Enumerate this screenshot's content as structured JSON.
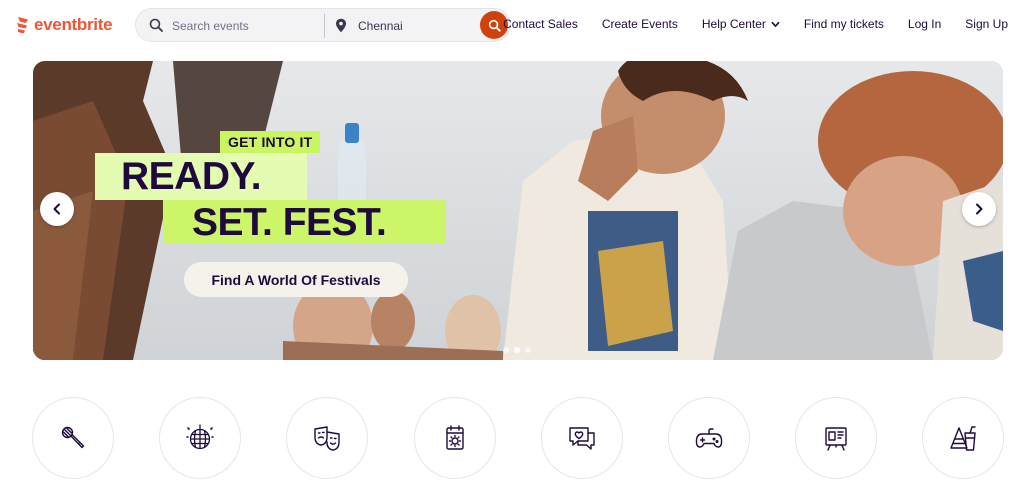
{
  "header": {
    "logo_text": "eventbrite",
    "brand_color": "#f05537",
    "search": {
      "placeholder": "Search events",
      "icon": "search-icon",
      "location_value": "Chennai",
      "location_icon": "map-pin-icon",
      "submit_icon": "search-icon",
      "submit_color": "#d1410c"
    },
    "nav": [
      {
        "label": "Contact Sales"
      },
      {
        "label": "Create Events"
      },
      {
        "label": "Help Center",
        "icon": "chevron-down-icon"
      },
      {
        "label": "Find my tickets"
      },
      {
        "label": "Log In"
      },
      {
        "label": "Sign Up"
      }
    ]
  },
  "hero": {
    "tag": "GET INTO IT",
    "line1": "READY.",
    "line2": "SET. FEST.",
    "cta": "Find A World Of Festivals",
    "accent_color": "#c8f560",
    "prev_icon": "chevron-left-icon",
    "next_icon": "chevron-right-icon",
    "slides_total": 3,
    "active_slide": 2
  },
  "categories": [
    {
      "icon": "microphone-icon"
    },
    {
      "icon": "disco-ball-icon"
    },
    {
      "icon": "theater-masks-icon"
    },
    {
      "icon": "calendar-icon"
    },
    {
      "icon": "chat-heart-icon"
    },
    {
      "icon": "game-controller-icon"
    },
    {
      "icon": "presentation-board-icon"
    },
    {
      "icon": "party-cup-icon"
    }
  ]
}
